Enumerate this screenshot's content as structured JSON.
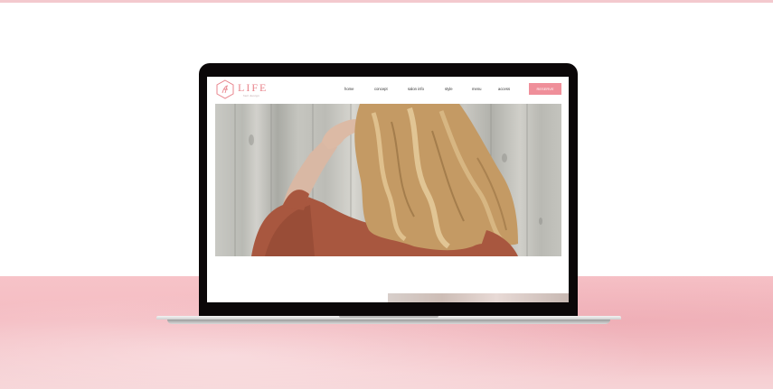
{
  "website": {
    "logo": {
      "text": "LIFE",
      "subtext": "hair design",
      "icon": "hexagon-monogram-icon"
    },
    "nav": {
      "items": [
        {
          "label": "home"
        },
        {
          "label": "concept"
        },
        {
          "label": "salon info"
        },
        {
          "label": "style"
        },
        {
          "label": "menu"
        },
        {
          "label": "access"
        }
      ],
      "reserve_label": "RESERVE"
    },
    "hero": {
      "image": "woman-with-wavy-blonde-hair-against-wooden-wall"
    }
  },
  "colors": {
    "accent": "#ef8f9a",
    "logo": "#e8848c",
    "background_surface": "#f6c4c9",
    "laptop_bezel": "#0b0708"
  }
}
